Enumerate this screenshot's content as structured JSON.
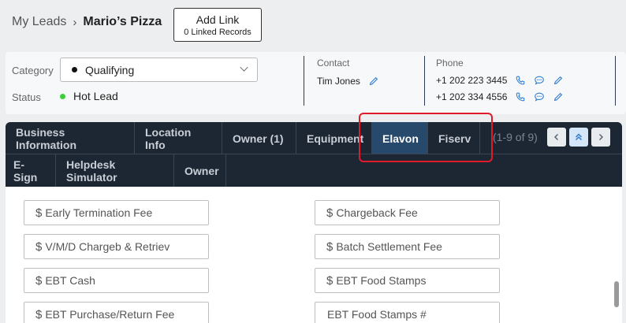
{
  "breadcrumb": {
    "root": "My Leads",
    "separator": "›",
    "current": "Mario’s Pizza"
  },
  "add_link": {
    "label": "Add Link",
    "sub": "0 Linked Records"
  },
  "info": {
    "category_label": "Category",
    "category_value": "Qualifying",
    "status_label": "Status",
    "status_value": "Hot Lead",
    "contact_label": "Contact",
    "contact_name": "Tim Jones",
    "phone_label": "Phone",
    "phones": [
      "+1 202 223 3445",
      "+1 202 334 4556"
    ]
  },
  "tabs_row1": [
    "Business Information",
    "Location Info",
    "Owner (1)",
    "Equipment",
    "Elavon",
    "Fiserv"
  ],
  "tabs_row2": [
    "E-Sign",
    "Helpdesk Simulator",
    "Owner"
  ],
  "active_tab": "Elavon",
  "pager": {
    "count": "(1-9 of 9)"
  },
  "fields": {
    "left": [
      {
        "prefix": "$",
        "placeholder": "Early Termination Fee"
      },
      {
        "prefix": "$",
        "placeholder": "V/M/D Chargeb & Retriev"
      },
      {
        "prefix": "$",
        "placeholder": "EBT Cash"
      },
      {
        "prefix": "$",
        "placeholder": "EBT Purchase/Return Fee"
      }
    ],
    "right": [
      {
        "prefix": "$",
        "placeholder": "Chargeback Fee"
      },
      {
        "prefix": "$",
        "placeholder": "Batch Settlement Fee"
      },
      {
        "prefix": "$",
        "placeholder": "EBT Food Stamps"
      },
      {
        "prefix": "",
        "placeholder": "EBT Food Stamps #"
      }
    ]
  },
  "colors": {
    "tab_bar": "#1d2733",
    "tab_active": "#26496c",
    "highlight": "#e21b2b",
    "status_dot": "#3ccf3c",
    "link_icon": "#2e7bd0"
  },
  "icons": {
    "phone": "phone-icon",
    "message": "message-icon",
    "edit": "pencil-icon",
    "chevron": "chevron-down-icon",
    "pager_prev": "chevron-left-icon",
    "pager_up": "double-chevron-up-icon",
    "pager_next": "chevron-right-icon"
  }
}
